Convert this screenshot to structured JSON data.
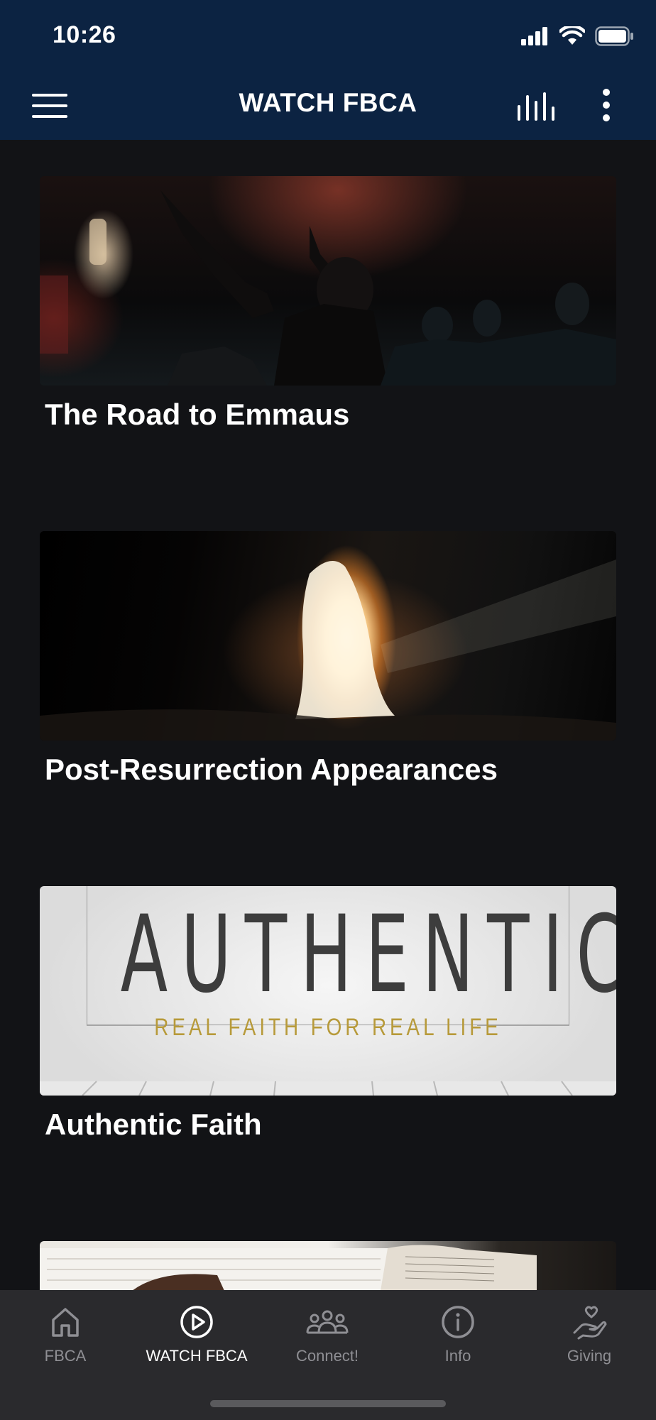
{
  "status_bar": {
    "time": "10:26"
  },
  "app_bar": {
    "title": "WATCH FBCA"
  },
  "cards": [
    {
      "title": "The Road to Emmaus"
    },
    {
      "title": "Post-Resurrection Appearances"
    },
    {
      "title": "Authentic Faith",
      "thumb_text": "AUTHENTIC",
      "thumb_subtitle": "REAL FAITH FOR REAL LIFE"
    }
  ],
  "tabs": [
    {
      "label": "FBCA",
      "icon": "home-icon"
    },
    {
      "label": "WATCH FBCA",
      "icon": "play-circle-icon"
    },
    {
      "label": "Connect!",
      "icon": "group-icon"
    },
    {
      "label": "Info",
      "icon": "info-icon"
    },
    {
      "label": "Giving",
      "icon": "giving-hand-icon"
    }
  ],
  "active_tab": "WATCH FBCA",
  "colors": {
    "header": "#0c2342",
    "background": "#121316",
    "tabbar": "#2a2a2d",
    "accent_gold": "#b79a3a"
  }
}
